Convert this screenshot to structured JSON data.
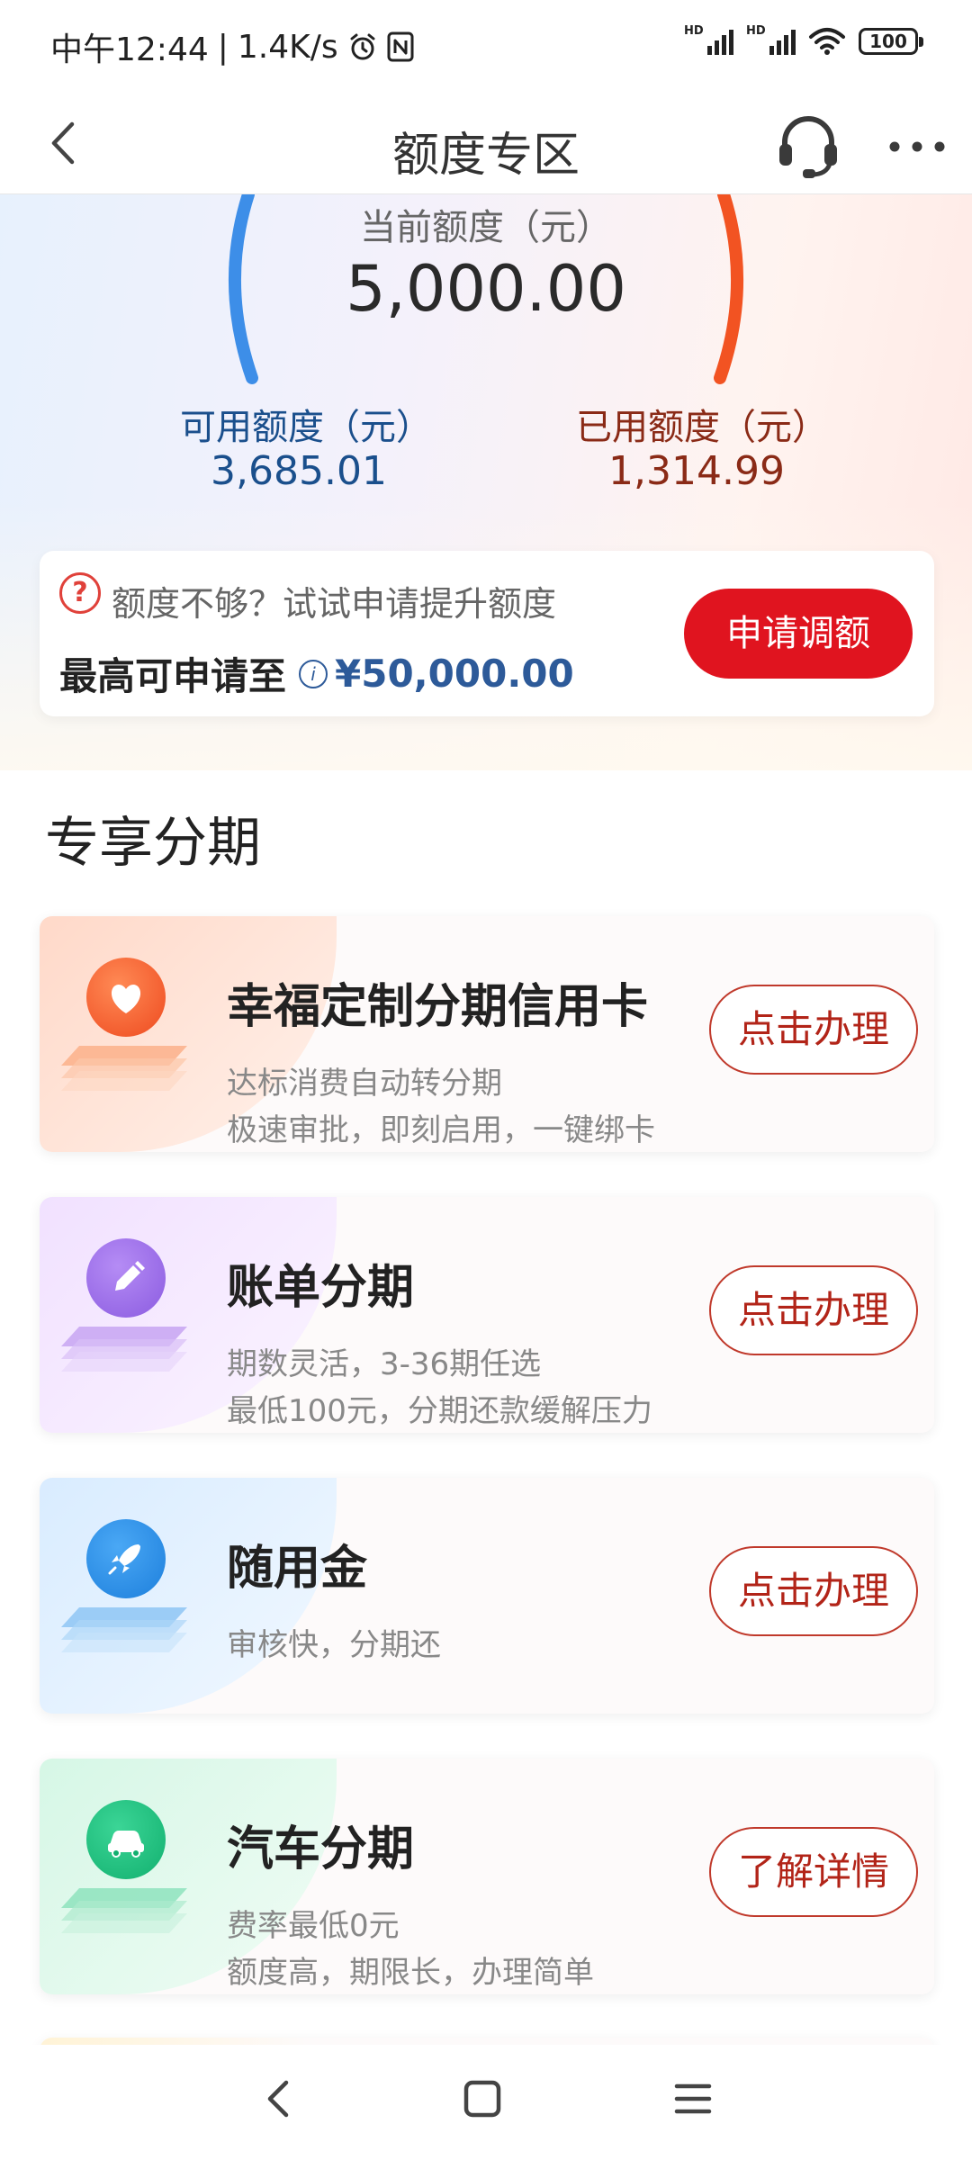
{
  "status": {
    "time": "中午12:44",
    "speed": "1.4K/s",
    "signal1_hd": "HD",
    "signal2_hd": "HD",
    "battery": "100"
  },
  "header": {
    "title": "额度专区",
    "back_icon": "chevron-left-icon",
    "support_icon": "headset-icon",
    "more_icon": "more-dots-icon"
  },
  "credit": {
    "current_label": "当前额度（元）",
    "current_value": "5,000.00",
    "available_label": "可用额度（元）",
    "available_value": "3,685.01",
    "used_label": "已用额度（元）",
    "used_value": "1,314.99"
  },
  "raise": {
    "hint": "额度不够？试试申请提升额度",
    "max_label": "最高可申请至",
    "max_amount": "¥50,000.00",
    "button": "申请调额"
  },
  "section": {
    "title": "专享分期"
  },
  "products": [
    {
      "title": "幸福定制分期信用卡",
      "line1": "达标消费自动转分期",
      "line2": "极速审批，即刻启用，一键绑卡",
      "button": "点击办理",
      "icon": "heart-icon",
      "color": "#f25c2f"
    },
    {
      "title": "账单分期",
      "line1": "期数灵活，3-36期任选",
      "line2": "最低100元，分期还款缓解压力",
      "button": "点击办理",
      "icon": "pencil-icon",
      "color": "#9b6be8"
    },
    {
      "title": "随用金",
      "line1": "审核快，分期还",
      "line2": "",
      "button": "点击办理",
      "icon": "rocket-icon",
      "color": "#2a8fe0"
    },
    {
      "title": "汽车分期",
      "line1": "费率最低0元",
      "line2": "额度高，期限长，办理简单",
      "button": "了解详情",
      "icon": "car-icon",
      "color": "#1fbf7f"
    }
  ],
  "nav": {
    "back_icon": "nav-back-icon",
    "home_icon": "nav-home-icon",
    "menu_icon": "nav-menu-icon"
  }
}
